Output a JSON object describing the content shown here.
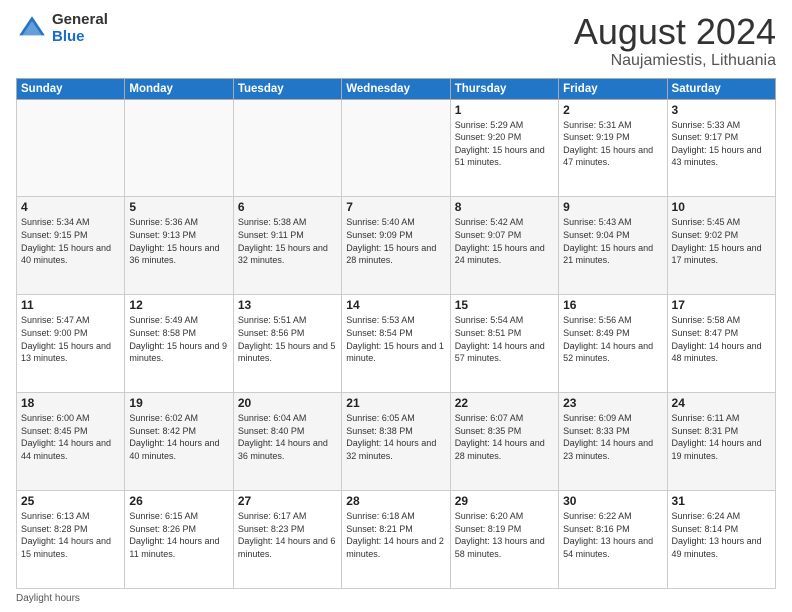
{
  "logo": {
    "general": "General",
    "blue": "Blue"
  },
  "title": {
    "month_year": "August 2024",
    "location": "Naujamiestis, Lithuania"
  },
  "days_of_week": [
    "Sunday",
    "Monday",
    "Tuesday",
    "Wednesday",
    "Thursday",
    "Friday",
    "Saturday"
  ],
  "footer": {
    "label": "Daylight hours"
  },
  "weeks": [
    [
      {
        "day": "",
        "info": ""
      },
      {
        "day": "",
        "info": ""
      },
      {
        "day": "",
        "info": ""
      },
      {
        "day": "",
        "info": ""
      },
      {
        "day": "1",
        "info": "Sunrise: 5:29 AM\nSunset: 9:20 PM\nDaylight: 15 hours\nand 51 minutes."
      },
      {
        "day": "2",
        "info": "Sunrise: 5:31 AM\nSunset: 9:19 PM\nDaylight: 15 hours\nand 47 minutes."
      },
      {
        "day": "3",
        "info": "Sunrise: 5:33 AM\nSunset: 9:17 PM\nDaylight: 15 hours\nand 43 minutes."
      }
    ],
    [
      {
        "day": "4",
        "info": "Sunrise: 5:34 AM\nSunset: 9:15 PM\nDaylight: 15 hours\nand 40 minutes."
      },
      {
        "day": "5",
        "info": "Sunrise: 5:36 AM\nSunset: 9:13 PM\nDaylight: 15 hours\nand 36 minutes."
      },
      {
        "day": "6",
        "info": "Sunrise: 5:38 AM\nSunset: 9:11 PM\nDaylight: 15 hours\nand 32 minutes."
      },
      {
        "day": "7",
        "info": "Sunrise: 5:40 AM\nSunset: 9:09 PM\nDaylight: 15 hours\nand 28 minutes."
      },
      {
        "day": "8",
        "info": "Sunrise: 5:42 AM\nSunset: 9:07 PM\nDaylight: 15 hours\nand 24 minutes."
      },
      {
        "day": "9",
        "info": "Sunrise: 5:43 AM\nSunset: 9:04 PM\nDaylight: 15 hours\nand 21 minutes."
      },
      {
        "day": "10",
        "info": "Sunrise: 5:45 AM\nSunset: 9:02 PM\nDaylight: 15 hours\nand 17 minutes."
      }
    ],
    [
      {
        "day": "11",
        "info": "Sunrise: 5:47 AM\nSunset: 9:00 PM\nDaylight: 15 hours\nand 13 minutes."
      },
      {
        "day": "12",
        "info": "Sunrise: 5:49 AM\nSunset: 8:58 PM\nDaylight: 15 hours\nand 9 minutes."
      },
      {
        "day": "13",
        "info": "Sunrise: 5:51 AM\nSunset: 8:56 PM\nDaylight: 15 hours\nand 5 minutes."
      },
      {
        "day": "14",
        "info": "Sunrise: 5:53 AM\nSunset: 8:54 PM\nDaylight: 15 hours\nand 1 minute."
      },
      {
        "day": "15",
        "info": "Sunrise: 5:54 AM\nSunset: 8:51 PM\nDaylight: 14 hours\nand 57 minutes."
      },
      {
        "day": "16",
        "info": "Sunrise: 5:56 AM\nSunset: 8:49 PM\nDaylight: 14 hours\nand 52 minutes."
      },
      {
        "day": "17",
        "info": "Sunrise: 5:58 AM\nSunset: 8:47 PM\nDaylight: 14 hours\nand 48 minutes."
      }
    ],
    [
      {
        "day": "18",
        "info": "Sunrise: 6:00 AM\nSunset: 8:45 PM\nDaylight: 14 hours\nand 44 minutes."
      },
      {
        "day": "19",
        "info": "Sunrise: 6:02 AM\nSunset: 8:42 PM\nDaylight: 14 hours\nand 40 minutes."
      },
      {
        "day": "20",
        "info": "Sunrise: 6:04 AM\nSunset: 8:40 PM\nDaylight: 14 hours\nand 36 minutes."
      },
      {
        "day": "21",
        "info": "Sunrise: 6:05 AM\nSunset: 8:38 PM\nDaylight: 14 hours\nand 32 minutes."
      },
      {
        "day": "22",
        "info": "Sunrise: 6:07 AM\nSunset: 8:35 PM\nDaylight: 14 hours\nand 28 minutes."
      },
      {
        "day": "23",
        "info": "Sunrise: 6:09 AM\nSunset: 8:33 PM\nDaylight: 14 hours\nand 23 minutes."
      },
      {
        "day": "24",
        "info": "Sunrise: 6:11 AM\nSunset: 8:31 PM\nDaylight: 14 hours\nand 19 minutes."
      }
    ],
    [
      {
        "day": "25",
        "info": "Sunrise: 6:13 AM\nSunset: 8:28 PM\nDaylight: 14 hours\nand 15 minutes."
      },
      {
        "day": "26",
        "info": "Sunrise: 6:15 AM\nSunset: 8:26 PM\nDaylight: 14 hours\nand 11 minutes."
      },
      {
        "day": "27",
        "info": "Sunrise: 6:17 AM\nSunset: 8:23 PM\nDaylight: 14 hours\nand 6 minutes."
      },
      {
        "day": "28",
        "info": "Sunrise: 6:18 AM\nSunset: 8:21 PM\nDaylight: 14 hours\nand 2 minutes."
      },
      {
        "day": "29",
        "info": "Sunrise: 6:20 AM\nSunset: 8:19 PM\nDaylight: 13 hours\nand 58 minutes."
      },
      {
        "day": "30",
        "info": "Sunrise: 6:22 AM\nSunset: 8:16 PM\nDaylight: 13 hours\nand 54 minutes."
      },
      {
        "day": "31",
        "info": "Sunrise: 6:24 AM\nSunset: 8:14 PM\nDaylight: 13 hours\nand 49 minutes."
      }
    ]
  ]
}
